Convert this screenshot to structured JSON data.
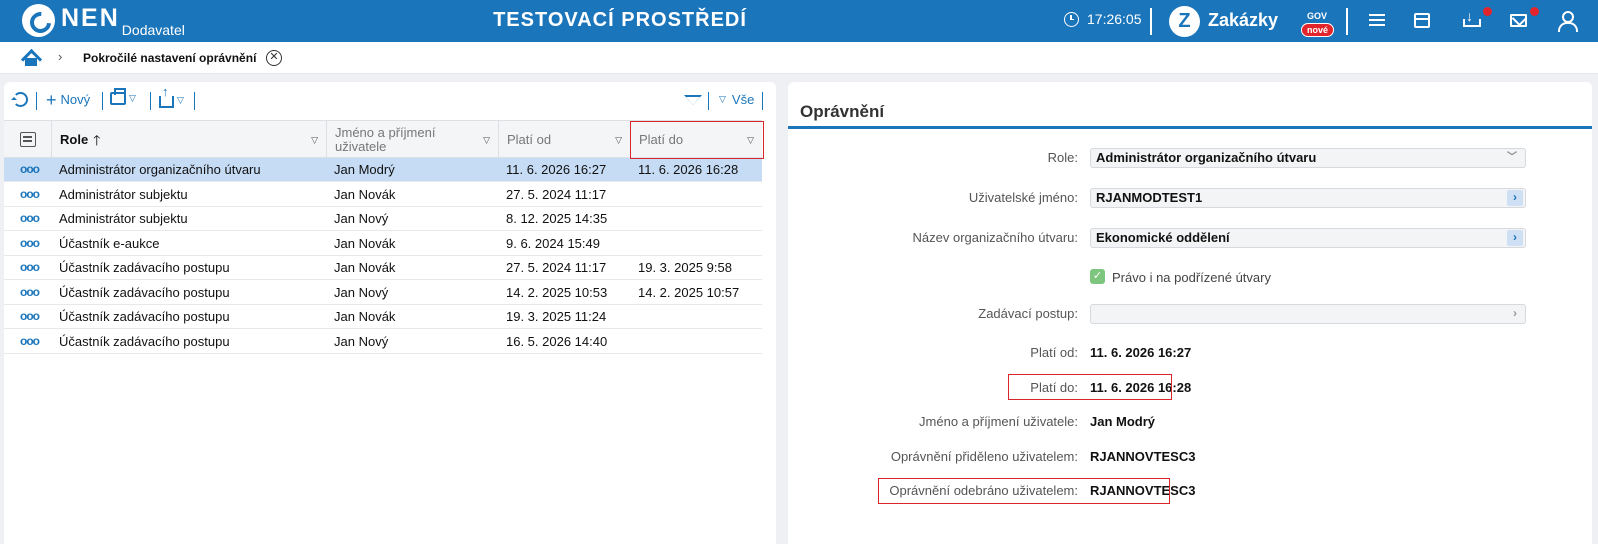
{
  "header": {
    "logo": "NEN",
    "logo_sub": "Dodavatel",
    "env_title": "TESTOVACÍ PROSTŘEDÍ",
    "time": "17:26:05",
    "zakazky": "Zakázky",
    "zakazky_gov": "GOV",
    "zakazky_new": "nové",
    "icons": [
      "menu-icon",
      "calendar-icon",
      "download-icon",
      "mail-icon",
      "user-icon"
    ]
  },
  "breadcrumb": {
    "title": "Pokročilé nastavení oprávnění",
    "close": "✕"
  },
  "toolbar": {
    "new_label": "Nový",
    "filter_label": "Vše"
  },
  "grid": {
    "columns": [
      "Role",
      "Jméno a příjmení uživatele",
      "Platí od",
      "Platí do"
    ],
    "sort_arrow": "🡑",
    "rows": [
      {
        "role": "Administrátor organizačního útvaru",
        "name": "Jan Modrý",
        "from": "11. 6. 2026 16:27",
        "to": "11. 6. 2026 16:28",
        "selected": true
      },
      {
        "role": "Administrátor subjektu",
        "name": "Jan Novák",
        "from": "27. 5. 2024 11:17",
        "to": ""
      },
      {
        "role": "Administrátor subjektu",
        "name": "Jan Nový",
        "from": "8. 12. 2025 14:35",
        "to": ""
      },
      {
        "role": "Účastník e-aukce",
        "name": "Jan Novák",
        "from": "9. 6. 2024 15:49",
        "to": ""
      },
      {
        "role": "Účastník zadávacího postupu",
        "name": "Jan Novák",
        "from": "27. 5. 2024 11:17",
        "to": "19. 3. 2025 9:58"
      },
      {
        "role": "Účastník zadávacího postupu",
        "name": "Jan Nový",
        "from": "14. 2. 2025 10:53",
        "to": "14. 2. 2025 10:57"
      },
      {
        "role": "Účastník zadávacího postupu",
        "name": "Jan Novák",
        "from": "19. 3. 2025 11:24",
        "to": ""
      },
      {
        "role": "Účastník zadávacího postupu",
        "name": "Jan Nový",
        "from": "16. 5. 2026 14:40",
        "to": ""
      }
    ]
  },
  "detail": {
    "title": "Oprávnění",
    "role_label": "Role:",
    "role_value": "Administrátor organizačního útvaru",
    "username_label": "Uživatelské jméno:",
    "username_value": "RJANMODTEST1",
    "org_label": "Název organizačního útvaru:",
    "org_value": "Ekonomické oddělení",
    "sub_units_label": "Právo i na podřízené útvary",
    "sub_units_checked": true,
    "procedure_label": "Zadávací postup:",
    "procedure_value": "",
    "valid_from_label": "Platí od:",
    "valid_from_value": "11. 6. 2026 16:27",
    "valid_to_label": "Platí do:",
    "valid_to_value": "11. 6. 2026 16:28",
    "user_name_label": "Jméno a příjmení uživatele:",
    "user_name_value": "Jan Modrý",
    "granted_by_label": "Oprávnění přiděleno uživatelem:",
    "granted_by_value": "RJANNOVTESC3",
    "revoked_by_label": "Oprávnění odebráno uživatelem:",
    "revoked_by_value": "RJANNOVTESC3"
  },
  "colors": {
    "brand": "#1b75bb",
    "selected_row": "#c6dbf4",
    "highlight": "#d9262c"
  }
}
